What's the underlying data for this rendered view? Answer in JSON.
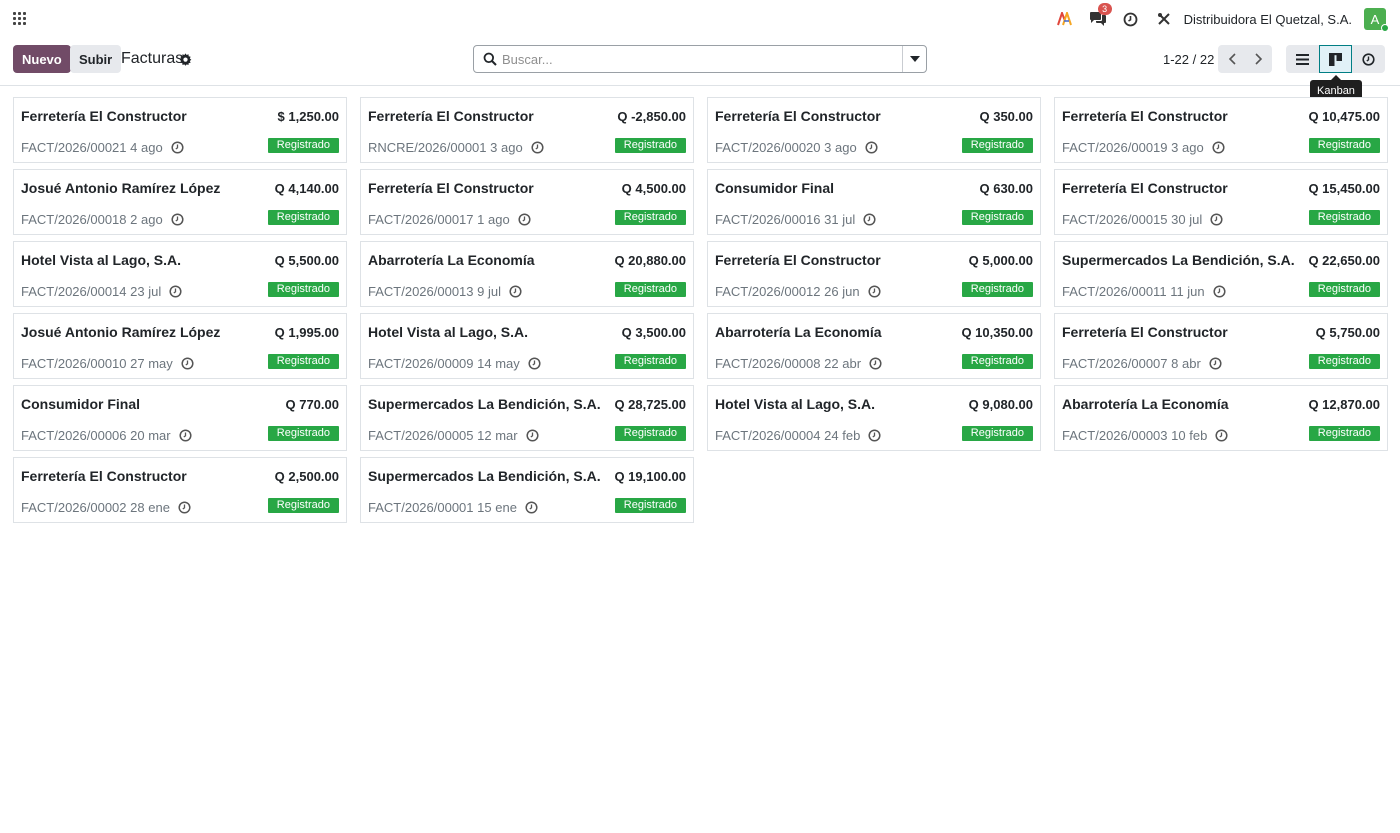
{
  "navbar": {
    "messages_badge": "3",
    "company": "Distribuidora El Quetzal, S.A.",
    "avatar_letter": "A"
  },
  "control": {
    "new_label": "Nuevo",
    "upload_label": "Subir",
    "title": "Facturas",
    "search_placeholder": "Buscar...",
    "pager": "1-22 / 22",
    "tooltip": "Kanban"
  },
  "colors": {
    "primary": "#714b67",
    "state": "#28a745",
    "active_view": "#017e84"
  },
  "invoices": [
    {
      "partner": "Ferretería El Constructor",
      "amount": "$ 1,250.00",
      "ref": "FACT/2026/00021",
      "date": "4 ago",
      "state": "Registrado"
    },
    {
      "partner": "Ferretería El Constructor",
      "amount": "Q -2,850.00",
      "ref": "RNCRE/2026/00001",
      "date": "3 ago",
      "state": "Registrado"
    },
    {
      "partner": "Ferretería El Constructor",
      "amount": "Q 350.00",
      "ref": "FACT/2026/00020",
      "date": "3 ago",
      "state": "Registrado"
    },
    {
      "partner": "Ferretería El Constructor",
      "amount": "Q 10,475.00",
      "ref": "FACT/2026/00019",
      "date": "3 ago",
      "state": "Registrado"
    },
    {
      "partner": "Josué Antonio Ramírez López",
      "amount": "Q 4,140.00",
      "ref": "FACT/2026/00018",
      "date": "2 ago",
      "state": "Registrado"
    },
    {
      "partner": "Ferretería El Constructor",
      "amount": "Q 4,500.00",
      "ref": "FACT/2026/00017",
      "date": "1 ago",
      "state": "Registrado"
    },
    {
      "partner": "Consumidor Final",
      "amount": "Q 630.00",
      "ref": "FACT/2026/00016",
      "date": "31 jul",
      "state": "Registrado"
    },
    {
      "partner": "Ferretería El Constructor",
      "amount": "Q 15,450.00",
      "ref": "FACT/2026/00015",
      "date": "30 jul",
      "state": "Registrado"
    },
    {
      "partner": "Hotel Vista al Lago, S.A.",
      "amount": "Q 5,500.00",
      "ref": "FACT/2026/00014",
      "date": "23 jul",
      "state": "Registrado"
    },
    {
      "partner": "Abarrotería La Economía",
      "amount": "Q 20,880.00",
      "ref": "FACT/2026/00013",
      "date": "9 jul",
      "state": "Registrado"
    },
    {
      "partner": "Ferretería El Constructor",
      "amount": "Q 5,000.00",
      "ref": "FACT/2026/00012",
      "date": "26 jun",
      "state": "Registrado"
    },
    {
      "partner": "Supermercados La Bendición, S.A.",
      "amount": "Q 22,650.00",
      "ref": "FACT/2026/00011",
      "date": "11 jun",
      "state": "Registrado"
    },
    {
      "partner": "Josué Antonio Ramírez López",
      "amount": "Q 1,995.00",
      "ref": "FACT/2026/00010",
      "date": "27 may",
      "state": "Registrado"
    },
    {
      "partner": "Hotel Vista al Lago, S.A.",
      "amount": "Q 3,500.00",
      "ref": "FACT/2026/00009",
      "date": "14 may",
      "state": "Registrado"
    },
    {
      "partner": "Abarrotería La Economía",
      "amount": "Q 10,350.00",
      "ref": "FACT/2026/00008",
      "date": "22 abr",
      "state": "Registrado"
    },
    {
      "partner": "Ferretería El Constructor",
      "amount": "Q 5,750.00",
      "ref": "FACT/2026/00007",
      "date": "8 abr",
      "state": "Registrado"
    },
    {
      "partner": "Consumidor Final",
      "amount": "Q 770.00",
      "ref": "FACT/2026/00006",
      "date": "20 mar",
      "state": "Registrado"
    },
    {
      "partner": "Supermercados La Bendición, S.A.",
      "amount": "Q 28,725.00",
      "ref": "FACT/2026/00005",
      "date": "12 mar",
      "state": "Registrado"
    },
    {
      "partner": "Hotel Vista al Lago, S.A.",
      "amount": "Q 9,080.00",
      "ref": "FACT/2026/00004",
      "date": "24 feb",
      "state": "Registrado"
    },
    {
      "partner": "Abarrotería La Economía",
      "amount": "Q 12,870.00",
      "ref": "FACT/2026/00003",
      "date": "10 feb",
      "state": "Registrado"
    },
    {
      "partner": "Ferretería El Constructor",
      "amount": "Q 2,500.00",
      "ref": "FACT/2026/00002",
      "date": "28 ene",
      "state": "Registrado"
    },
    {
      "partner": "Supermercados La Bendición, S.A.",
      "amount": "Q 19,100.00",
      "ref": "FACT/2026/00001",
      "date": "15 ene",
      "state": "Registrado"
    }
  ]
}
